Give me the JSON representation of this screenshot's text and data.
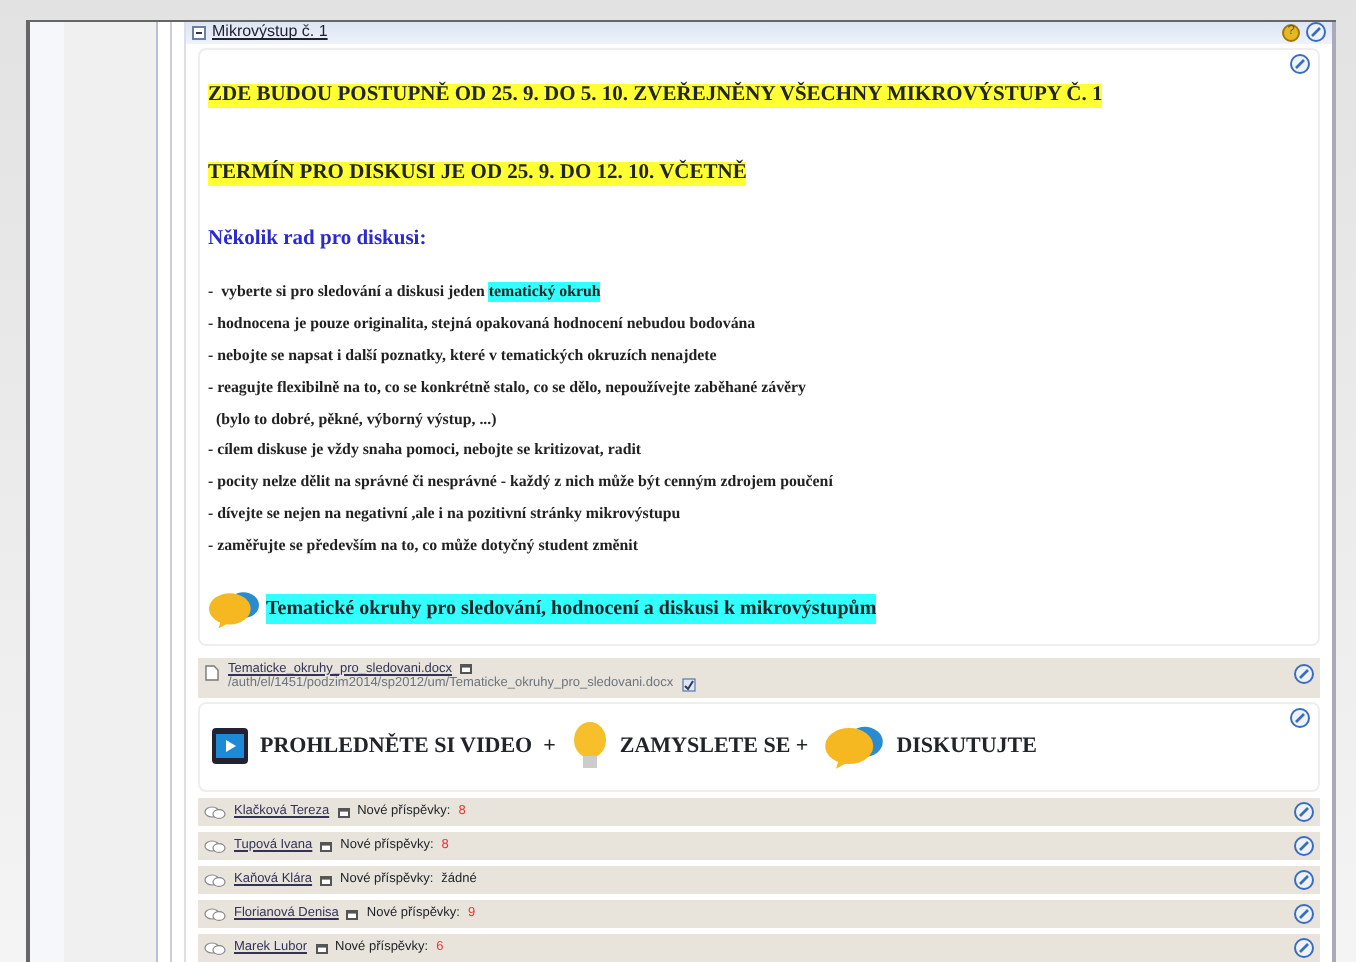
{
  "section": {
    "title": "Mikrovýstup č. 1",
    "help": "?"
  },
  "blocks": [
    {
      "kind": "banner",
      "text": "ZDE BUDOU POSTUPNĚ OD 25. 9. DO 5. 10. ZVEŘEJNĚNY VŠECHNY MIKROVÝSTUPY Č. 1"
    },
    {
      "kind": "banner",
      "text": "TERMÍN PRO DISKUSI JE OD 25. 9. DO 12. 10. VČETNĚ"
    },
    {
      "kind": "heading",
      "text": "Několik rad pro diskusi:"
    },
    {
      "kind": "tip",
      "text": "-  vyberte si pro sledování a diskusi jeden ",
      "highlight": "tematický okruh"
    },
    {
      "kind": "tip",
      "text": "- hodnocena je pouze originalita, stejná opakovaná hodnocení nebudou bodována"
    },
    {
      "kind": "tip",
      "text": "- nebojte se napsat i další poznatky, které v tematických okruzích nenajdete"
    },
    {
      "kind": "tip",
      "text": "- reagujte flexibilně na to, co se konkrétně stalo, co se dělo, nepoužívejte zaběhané závěry"
    },
    {
      "kind": "tip",
      "text": "  (bylo to dobré, pěkné, výborný výstup, ...)"
    },
    {
      "kind": "tip",
      "text": "- cílem diskuse je vždy snaha pomoci, nebojte se kritizovat, radit"
    },
    {
      "kind": "tip",
      "text": "- pocity nelze dělit na správné či nesprávné - každý z nich může být cenným zdrojem poučení"
    },
    {
      "kind": "tip",
      "text": "- dívejte se nejen na negativní ,ale i na pozitivní stránky mikrovýstupu"
    },
    {
      "kind": "tip",
      "text": "- zaměřujte se především na to, co může dotyčný student změnit"
    }
  ],
  "topics_link": {
    "text": "Tematické okruhy pro sledování, hodnocení a diskusi k mikrovýstupům"
  },
  "file": {
    "name": "Tematicke_okruhy_pro_sledovani.docx",
    "path": "/auth/el/1451/podzim2014/sp2012/um/Tematicke_okruhy_pro_sledovani.docx"
  },
  "steps": [
    {
      "kind": "video",
      "text": "PROHLEDNĚTE SI VIDEO  +"
    },
    {
      "kind": "idea",
      "text": "ZAMYSLETE SE +"
    },
    {
      "kind": "discussion",
      "text": "DISKUTUJTE"
    }
  ],
  "forums": [
    {
      "name": "Klačková Tereza",
      "new_label": "Nové příspěvky:",
      "count": "8",
      "has_new": true
    },
    {
      "name": "Tupová Ivana",
      "new_label": "Nové příspěvky:",
      "count": "8",
      "has_new": true
    },
    {
      "name": "Kaňová Klára",
      "new_label": "Nové příspěvky:",
      "count": "žádné",
      "has_new": false
    },
    {
      "name": "Florianová Denisa",
      "new_label": "Nové příspěvky:",
      "count": "9",
      "has_new": true
    },
    {
      "name": "Marek Lubor",
      "new_label": "Nové příspěvky:",
      "count": "6",
      "has_new": true
    }
  ]
}
